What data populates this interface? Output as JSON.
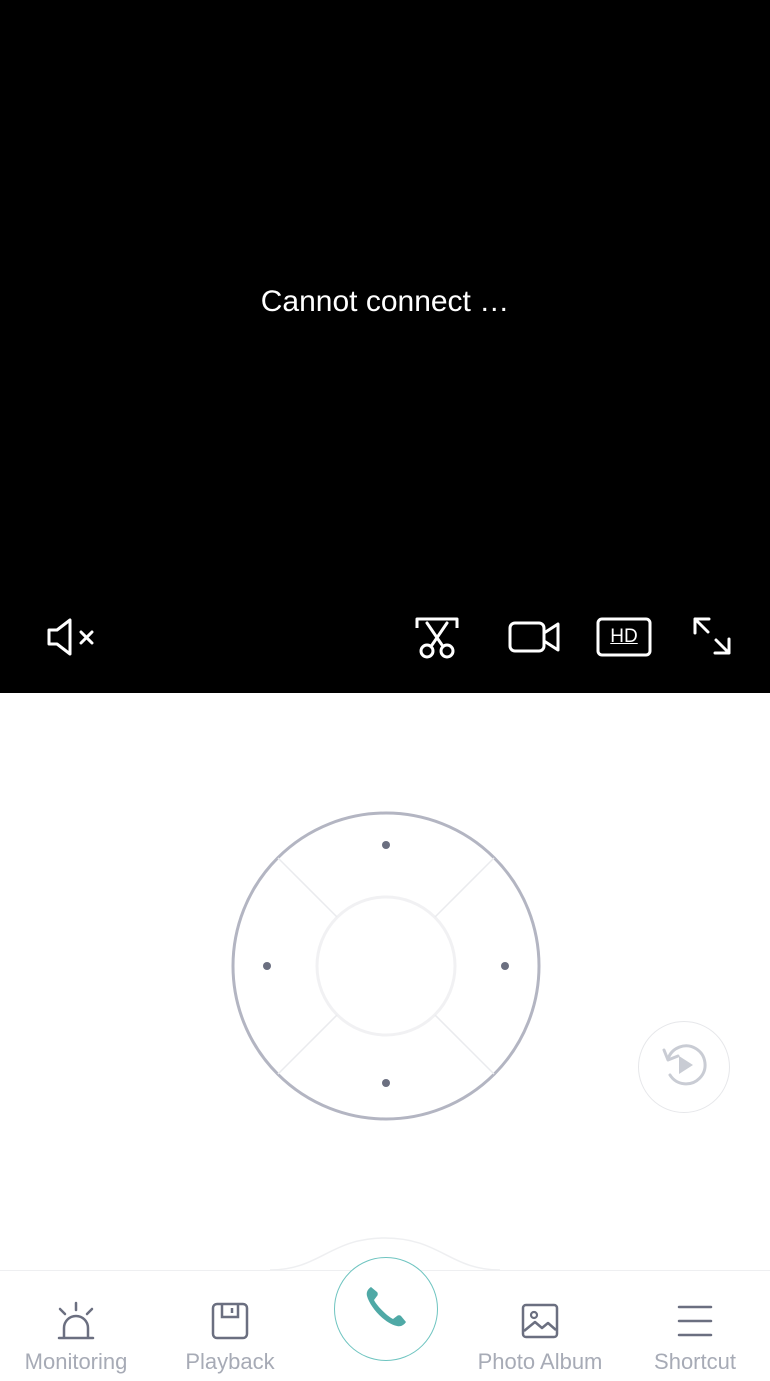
{
  "video": {
    "status_text": "Cannot connect …",
    "background": "#000000",
    "toolbar": {
      "mute_icon": "speaker-muted-icon",
      "screenshot_icon": "scissors-icon",
      "record_icon": "video-camera-icon",
      "quality_label": "HD",
      "fullscreen_icon": "expand-icon"
    }
  },
  "ptz": {
    "directions": [
      "up",
      "right",
      "down",
      "left"
    ],
    "ring_color": "#b3b5c2",
    "dot_color": "#6b6f80"
  },
  "replay": {
    "icon": "replay-icon"
  },
  "tabbar": {
    "tabs": [
      {
        "label": "Monitoring",
        "icon": "alarm-light-icon"
      },
      {
        "label": "Playback",
        "icon": "floppy-disk-icon"
      },
      {
        "label": "Photo Album",
        "icon": "picture-icon"
      },
      {
        "label": "Shortcut",
        "icon": "menu-icon"
      }
    ],
    "call_icon": "phone-icon",
    "call_color": "#4fa9a6",
    "label_color": "#a7abb6",
    "icon_color": "#6b6f80"
  }
}
